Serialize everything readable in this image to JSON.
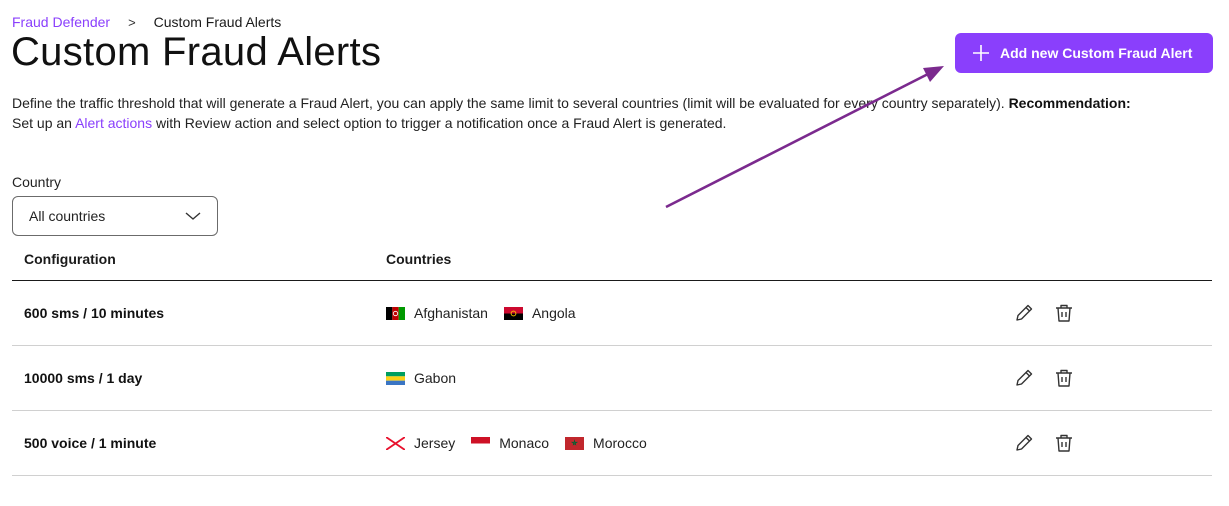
{
  "breadcrumb": {
    "parent": "Fraud Defender",
    "separator": ">",
    "current": "Custom Fraud Alerts"
  },
  "page": {
    "title": "Custom Fraud Alerts"
  },
  "add_button": {
    "label": "Add new Custom Fraud Alert"
  },
  "description": {
    "line1": "Define the traffic threshold that will generate a Fraud Alert, you can apply the same limit to several countries (limit will be evaluated for every country separately).",
    "recommendation_label": "Recommendation:",
    "line2_prefix": "Set up an",
    "link": "Alert actions",
    "line2_suffix": "with Review action and select option to trigger a notification once a Fraud Alert is generated."
  },
  "filter": {
    "label": "Country",
    "selected": "All countries"
  },
  "table": {
    "headers": {
      "configuration": "Configuration",
      "countries": "Countries"
    },
    "rows": [
      {
        "configuration": "600 sms / 10 minutes",
        "countries": [
          "Afghanistan",
          "Angola"
        ]
      },
      {
        "configuration": "10000 sms / 1 day",
        "countries": [
          "Gabon"
        ]
      },
      {
        "configuration": "500 voice / 1 minute",
        "countries": [
          "Jersey",
          "Monaco",
          "Morocco"
        ]
      }
    ]
  },
  "colors": {
    "accent": "#8a3ffc",
    "arrow": "#7b2a8e"
  },
  "icons": {
    "add": "plus-icon",
    "edit": "pencil-icon",
    "delete": "trash-icon",
    "dropdown": "chevron-down-icon"
  }
}
